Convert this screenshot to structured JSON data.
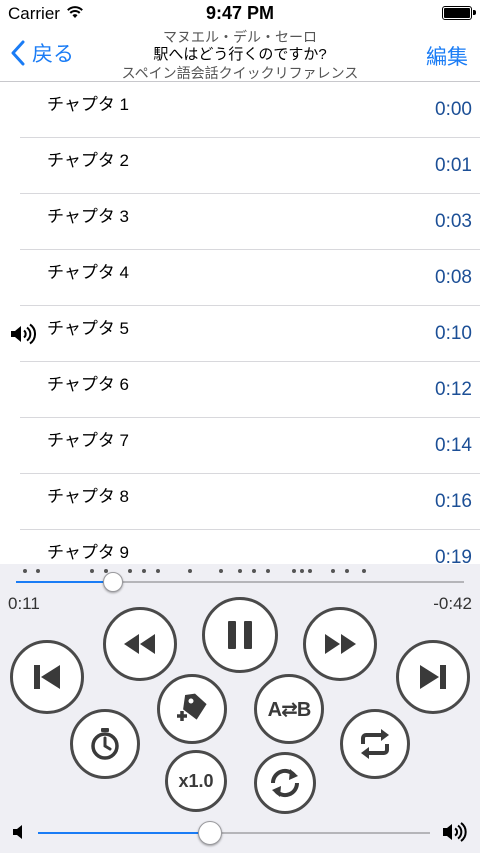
{
  "status": {
    "carrier": "Carrier",
    "time": "9:47 PM"
  },
  "nav": {
    "back_label": "戻る",
    "author": "マヌエル・デル・セーロ",
    "title": "駅へはどう行くのですか?",
    "subtitle": "スペイン語会話クイックリファレンス",
    "edit_label": "編集"
  },
  "chapters": [
    {
      "name": "チャプタ 1",
      "duration": "0:00"
    },
    {
      "name": "チャプタ 2",
      "duration": "0:01"
    },
    {
      "name": "チャプタ 3",
      "duration": "0:03"
    },
    {
      "name": "チャプタ 4",
      "duration": "0:08"
    },
    {
      "name": "チャプタ 5",
      "duration": "0:10",
      "playing": true
    },
    {
      "name": "チャプタ 6",
      "duration": "0:12"
    },
    {
      "name": "チャプタ 7",
      "duration": "0:14"
    },
    {
      "name": "チャプタ 8",
      "duration": "0:16"
    },
    {
      "name": "チャプタ 9",
      "duration": "0:19"
    }
  ],
  "player": {
    "elapsed": "0:11",
    "remaining": "-0:42",
    "progress_fraction": 0.217,
    "volume_fraction": 0.44,
    "speed_label": "x1.0",
    "ab_label": "A⇄B",
    "accent_color": "#1a7cf5",
    "duration_color": "#1c4f96",
    "icons": [
      "skip-back-icon",
      "rewind-icon",
      "pause-icon",
      "fast-forward-icon",
      "skip-forward-icon",
      "add-tag-icon",
      "ab-repeat-icon",
      "timer-icon",
      "repeat-icon",
      "speed-icon",
      "shuffle-icon",
      "volume-low-icon",
      "volume-high-icon"
    ]
  }
}
